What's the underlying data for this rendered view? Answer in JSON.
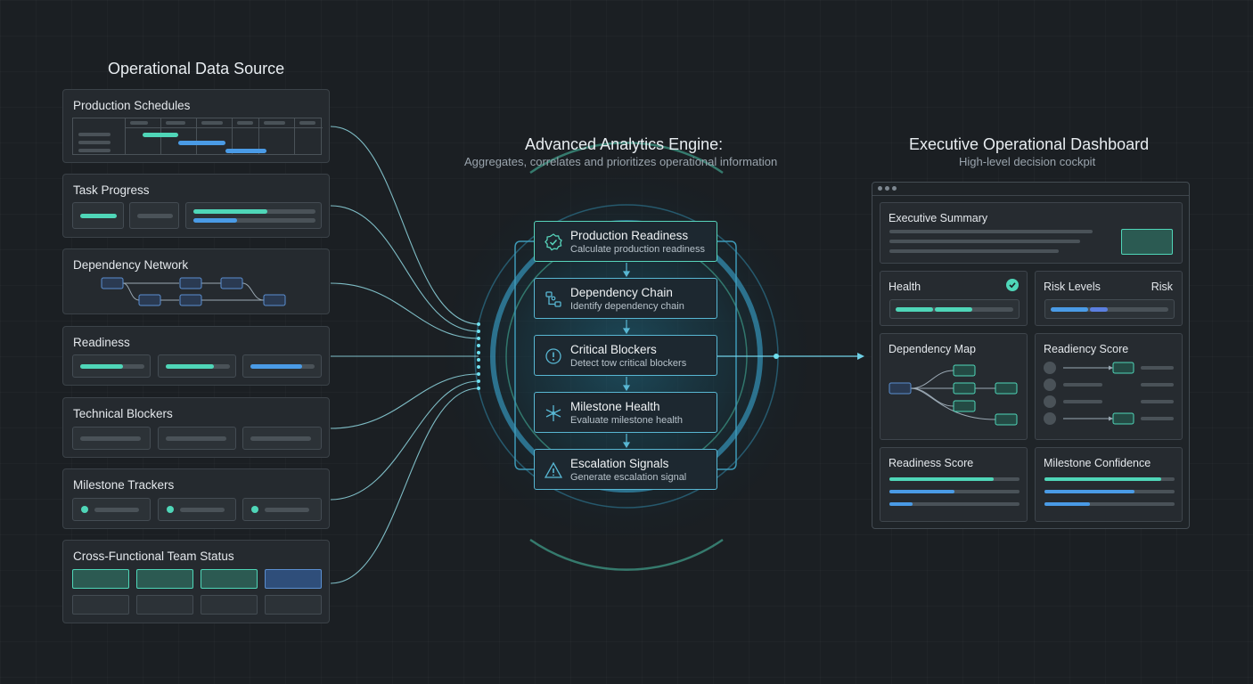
{
  "source": {
    "heading": "Operational Data Source",
    "cards": [
      {
        "title": "Production Schedules"
      },
      {
        "title": "Task Progress"
      },
      {
        "title": "Dependency Network"
      },
      {
        "title": "Readiness"
      },
      {
        "title": "Technical Blockers"
      },
      {
        "title": "Milestone Trackers"
      },
      {
        "title": "Cross-Functional Team Status"
      }
    ]
  },
  "engine": {
    "heading": "Advanced Analytics Engine:",
    "subheading": "Aggregates, correlates and prioritizes operational information",
    "steps": [
      {
        "title": "Production Readiness",
        "subtitle": "Calculate production readiness",
        "icon": "badge-check-icon"
      },
      {
        "title": "Dependency Chain",
        "subtitle": "Identify dependency chain",
        "icon": "flow-icon"
      },
      {
        "title": "Critical Blockers",
        "subtitle": "Detect tow critical blockers",
        "icon": "alert-circle-icon"
      },
      {
        "title": "Milestone Health",
        "subtitle": "Evaluate milestone health",
        "icon": "pulse-icon"
      },
      {
        "title": "Escalation Signals",
        "subtitle": "Generate escalation signal",
        "icon": "warning-triangle-icon"
      }
    ]
  },
  "dashboard": {
    "heading": "Executive Operational Dashboard",
    "subheading": "High-level decision cockpit",
    "executive_summary": "Executive Summary",
    "health": "Health",
    "risk_levels": "Risk Levels",
    "risk_tag": "Risk",
    "dependency_map": "Dependency Map",
    "readiency_score": "Readiency Score",
    "readiness_score": "Readiness Score",
    "milestone_confidence": "Milestone Confidence",
    "readiness_bars": [
      0.8,
      0.5,
      0.18
    ],
    "confidence_bars": [
      0.9,
      0.69,
      0.35
    ]
  },
  "colors": {
    "teal": "#4fd6b8",
    "blue": "#4a9be6",
    "background": "#1b1f23"
  }
}
